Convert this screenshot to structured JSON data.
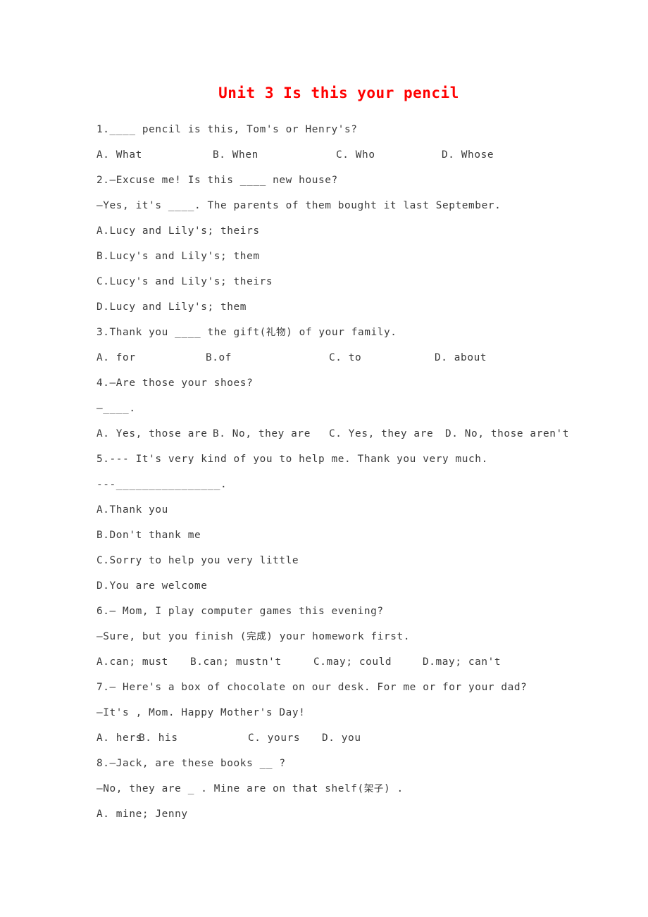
{
  "document": {
    "title": "Unit 3 Is this your pencil",
    "title_color": "#ff0000",
    "body_color": "#3a3a3a",
    "background": "#ffffff"
  },
  "questions": [
    {
      "number": "1",
      "stem": "1.____ pencil is this, Tom's or Henry's?",
      "options_inline": [
        "A. What",
        "B. When",
        "C. Who",
        "D. Whose"
      ]
    },
    {
      "number": "2",
      "stem_line1": "2.—Excuse me! Is this ____ new house?",
      "stem_line2": "—Yes, it's ____. The parents of them bought it last September.",
      "options_stacked": [
        "A.Lucy and Lily's; theirs",
        "B.Lucy's and Lily's; them",
        "C.Lucy's and Lily's; theirs",
        "D.Lucy and Lily's; them"
      ]
    },
    {
      "number": "3",
      "stem_pre": "3.Thank you ____ the gift(",
      "stem_cjk": "礼物",
      "stem_post": ") of your family.",
      "options_inline": [
        "A. for",
        "B.of",
        "C. to",
        "D. about"
      ]
    },
    {
      "number": "4",
      "stem_line1": "4.—Are those your shoes?",
      "stem_line2": "—____.",
      "options_inline": [
        "A. Yes, those are",
        "B. No, they are",
        "C. Yes, they are",
        "D. No, those aren't"
      ]
    },
    {
      "number": "5",
      "stem_line1": "5.--- It's very kind of you to help me. Thank you very much.",
      "stem_line2": "---________________.",
      "options_stacked": [
        "A.Thank you",
        "B.Don't thank me",
        "C.Sorry to help you very little",
        "D.You are welcome"
      ]
    },
    {
      "number": "6",
      "stem_line1": "6.— Mom, I play computer games this evening?",
      "stem_line2_pre": "—Sure, but you finish (",
      "stem_line2_cjk": "完成",
      "stem_line2_post": ") your homework first.",
      "options_inline": [
        "A.can; must",
        "B.can; mustn't",
        "C.may; could",
        "D.may; can't"
      ]
    },
    {
      "number": "7",
      "stem_line1": "7.— Here's a box of chocolate on our desk. For me or for your dad?",
      "stem_line2": "—It's , Mom. Happy Mother's Day!",
      "options_inline": [
        "A. hers",
        "B. his",
        "C. yours",
        "D. you"
      ]
    },
    {
      "number": "8",
      "stem_line1": "8.—Jack, are these books __ ?",
      "stem_line2_pre": "—No, they are _ . Mine are on that shelf(",
      "stem_line2_cjk": "架子",
      "stem_line2_post": ") .",
      "options_stacked": [
        "A. mine; Jenny"
      ]
    }
  ]
}
